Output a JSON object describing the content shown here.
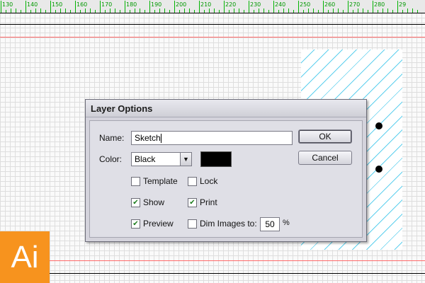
{
  "ruler": {
    "labels": [
      "130",
      "140",
      "150",
      "160",
      "170",
      "180",
      "190",
      "200",
      "210",
      "220",
      "230",
      "240",
      "250",
      "260",
      "270",
      "280",
      "29"
    ]
  },
  "dialog": {
    "title": "Layer Options",
    "name_label": "Name:",
    "name_value": "Sketch",
    "color_label": "Color:",
    "color_value": "Black",
    "color_swatch": "#000000",
    "ok_label": "OK",
    "cancel_label": "Cancel",
    "options": {
      "template": {
        "label": "Template",
        "checked": false
      },
      "lock": {
        "label": "Lock",
        "checked": false
      },
      "show": {
        "label": "Show",
        "checked": true
      },
      "print": {
        "label": "Print",
        "checked": true
      },
      "preview": {
        "label": "Preview",
        "checked": true
      },
      "dim_images": {
        "label": "Dim Images to:",
        "checked": false
      }
    },
    "dim_value": "50",
    "dim_unit": "%"
  },
  "logo": {
    "text": "Ai",
    "color": "#f7931e"
  },
  "colors": {
    "ruler_green": "#00b400",
    "guide_red": "#ff5a5a",
    "hatch": "#5fd0ee"
  }
}
